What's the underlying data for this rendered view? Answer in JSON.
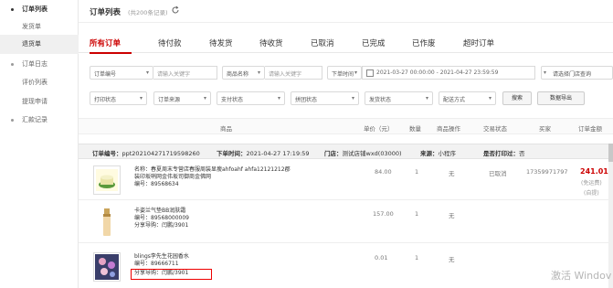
{
  "sidebar": {
    "items": [
      {
        "label": "订单列表"
      },
      {
        "label": "发货单"
      },
      {
        "label": "退货单"
      },
      {
        "label": "订单日志"
      },
      {
        "label": "评价列表"
      },
      {
        "label": "提现申请"
      },
      {
        "label": "汇款记录"
      }
    ],
    "active_index": 2
  },
  "header": {
    "title": "订单列表",
    "count": "(共200条记录)"
  },
  "tabs": [
    "所有订单",
    "待付款",
    "待发货",
    "待收货",
    "已取消",
    "已完成",
    "已作废",
    "超时订单"
  ],
  "filters_row1": {
    "order_no_select": "订单编号",
    "keyword_placeholder1": "请输入关键字",
    "product_name_select": "商品名称",
    "keyword_placeholder2": "请输入关键字",
    "time_select": "下单时间",
    "date_range": "2021-03-27 00:00:00 - 2021-04-27 23:59:59",
    "store_select": "请选择门店查询"
  },
  "filters_row2": {
    "print_status": "打印状态",
    "order_source": "订单来源",
    "pay_status": "支付状态",
    "group_status": "拼团状态",
    "ship_status": "发货状态",
    "delivery_method": "配送方式",
    "search_button": "搜索",
    "export_button": "数据导出"
  },
  "table_header": {
    "product": "商品",
    "unit_price": "单价（元）",
    "qty": "数量",
    "product_op": "商品操作",
    "trade_status": "交易状态",
    "buyer": "买家",
    "order_amount": "订单金额"
  },
  "order": {
    "order_no_label": "订单编号：",
    "order_no": "ppt20210427171959826​0",
    "time_label": "下单时间：",
    "time": "2021-04-27 17:19:59",
    "store_label": "门店：",
    "store": "测试店铺wxd(03000)",
    "source_label": "来源：",
    "source": "小程序",
    "printed_label": "是否打印过：",
    "printed": "否",
    "trade_status": "已取消",
    "buyer": "17359971797",
    "amount": "241.01",
    "shipping_note": "(免运费)",
    "pickup_note": "(自提)",
    "items": [
      {
        "name_line1": "名称：春夏周末专营店春服周装显瘦ahfoahf ahfa12121212郡",
        "name_line2": "装印坂哨网金伟坂司御商金佛网",
        "code": "编号：89568634",
        "guide": "",
        "price": "84.00",
        "qty": "1",
        "op": "无"
      },
      {
        "name_line1": "卡姿兰气垫BB润肤霜",
        "name_line2": "",
        "code": "编号：89568000009",
        "guide": "分享导购：闫鹏/3901",
        "price": "157.00",
        "qty": "1",
        "op": "无"
      },
      {
        "name_line1": "blings李先生花园香水",
        "name_line2": "",
        "code": "编号：89666711",
        "guide": "分享导购：闫鹏/3901",
        "price": "0.01",
        "qty": "1",
        "op": "无"
      }
    ]
  },
  "watermark": "激活 Windov"
}
